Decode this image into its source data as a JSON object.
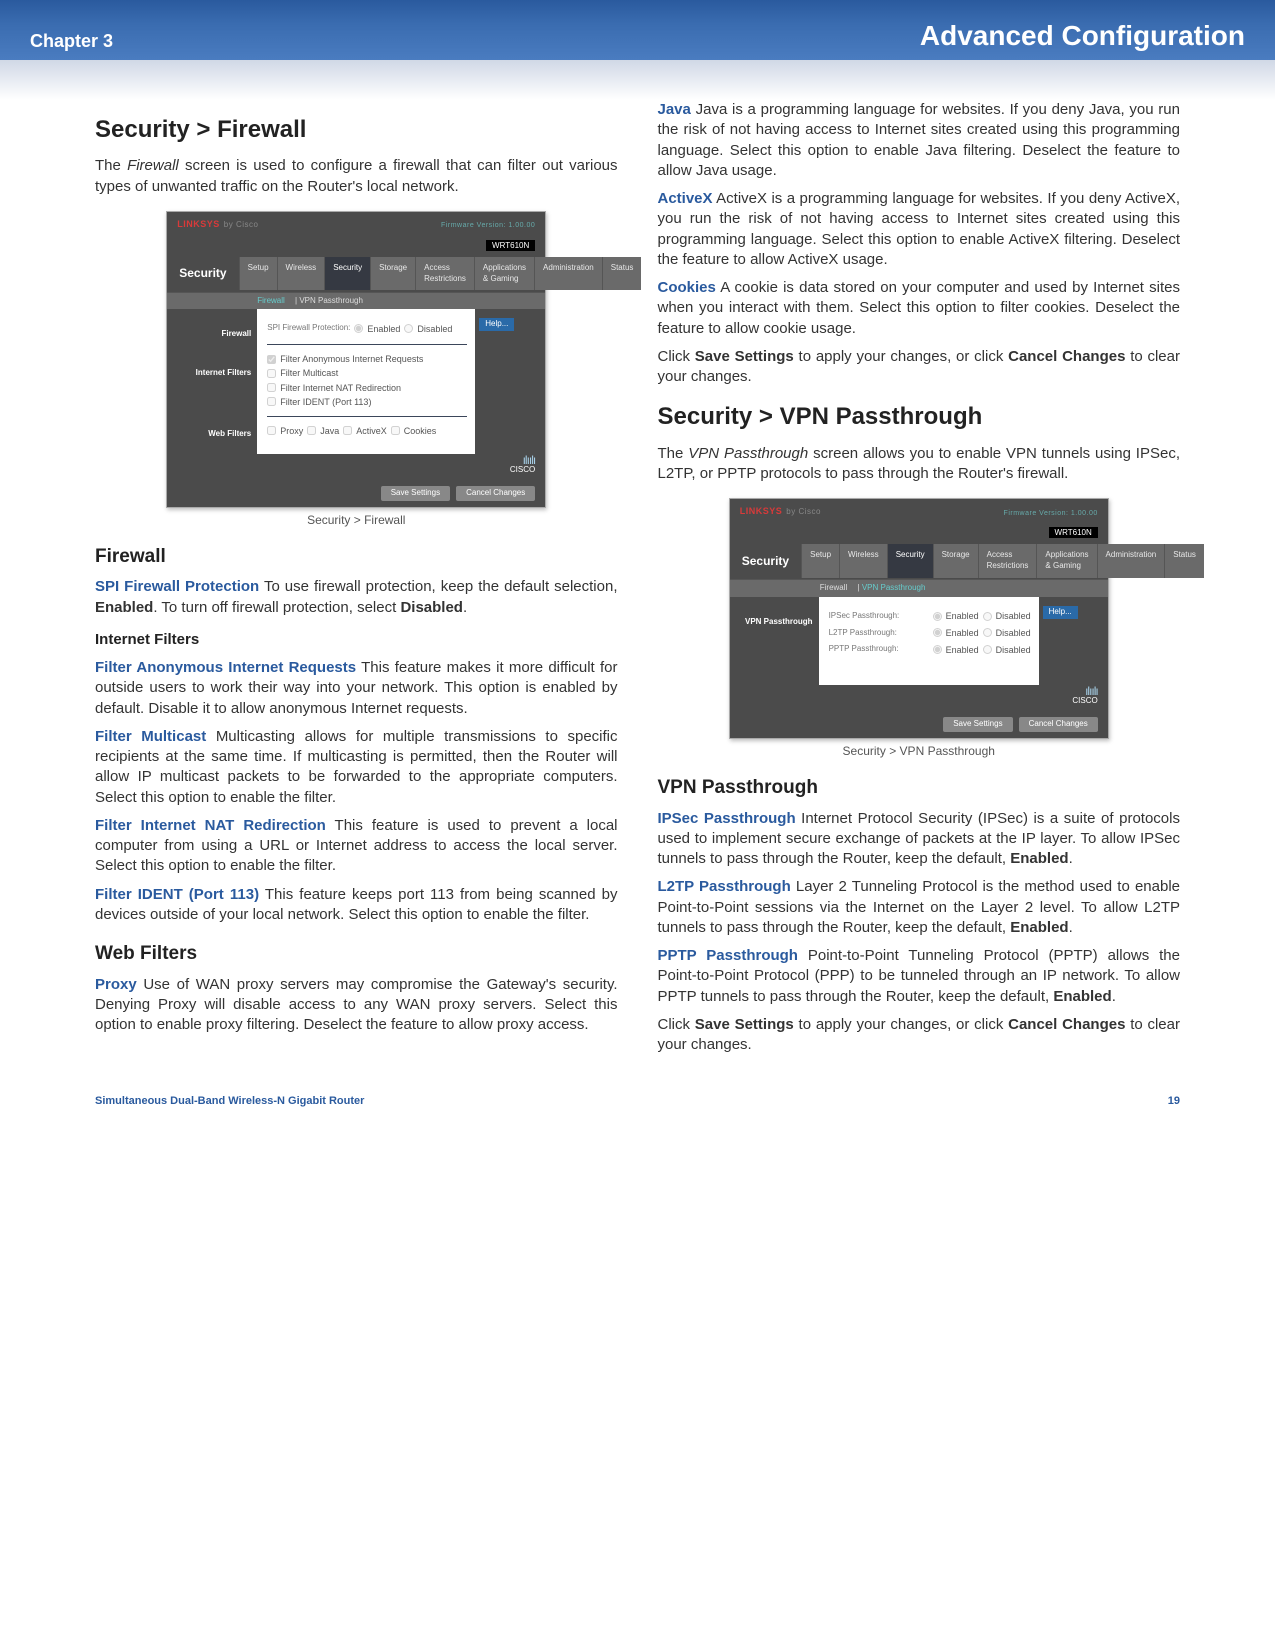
{
  "header": {
    "chapter": "Chapter 3",
    "title": "Advanced Configuration"
  },
  "footer": {
    "product": "Simultaneous Dual-Band Wireless-N Gigabit Router",
    "page": "19"
  },
  "shot_common": {
    "brand": "LINKSYS",
    "by": "by Cisco",
    "fw": "Firmware Version: 1.00.00",
    "model": "WRT610N",
    "maintab": "Security",
    "nav": [
      "Setup",
      "Wireless",
      "Security",
      "Storage",
      "Access Restrictions",
      "Applications & Gaming",
      "Administration",
      "Status"
    ],
    "help": "Help...",
    "save_btn": "Save Settings",
    "cancel_btn": "Cancel Changes",
    "cisco_bars": "ılıılı",
    "cisco_txt": "CISCO"
  },
  "shot1": {
    "subtabs_a": "Firewall",
    "subtabs_b": "VPN Passthrough",
    "side1": "Firewall",
    "side2": "Internet Filters",
    "side3": "Web Filters",
    "spi_label": "SPI Firewall Protection:",
    "spi_enabled": "Enabled",
    "spi_disabled": "Disabled",
    "f1": "Filter Anonymous Internet Requests",
    "f2": "Filter Multicast",
    "f3": "Filter Internet NAT Redirection",
    "f4": "Filter IDENT (Port 113)",
    "w1": "Proxy",
    "w2": "Java",
    "w3": "ActiveX",
    "w4": "Cookies",
    "caption": "Security > Firewall"
  },
  "shot2": {
    "subtabs_a": "Firewall",
    "subtabs_b": "VPN Passthrough",
    "side1": "VPN Passthrough",
    "r1": "IPSec Passthrough:",
    "r2": "L2TP Passthrough:",
    "r3": "PPTP Passthrough:",
    "en": "Enabled",
    "dis": "Disabled",
    "caption": "Security > VPN Passthrough"
  },
  "sec": {
    "h_firewall_page": "Security > Firewall",
    "p_firewall_intro": "The Firewall screen is used to configure a firewall that can filter out various types of unwanted traffic on the Router's local network.",
    "h_firewall": "Firewall",
    "t_spi": "SPI Firewall Protection",
    "p_spi": " To use firewall protection, keep the default selection, Enabled. To turn off firewall protection, select Disabled.",
    "h_intfilters": "Internet Filters",
    "t_anon": "Filter Anonymous Internet Requests",
    "p_anon": " This feature makes it more difficult for outside users to work their way into your network. This option is enabled by default. Disable it to allow anonymous Internet requests.",
    "t_multi": "Filter Multicast",
    "p_multi": " Multicasting allows for multiple transmissions to specific recipients at the same time. If multicasting is permitted, then the Router will allow IP multicast packets to be forwarded to the appropriate computers. Select this option to enable the filter.",
    "t_nat": "Filter Internet NAT Redirection",
    "p_nat": "  This feature is used to prevent a local computer from using a URL or Internet address to access the local server. Select this option to enable the filter.",
    "t_ident": "Filter IDENT (Port 113)",
    "p_ident": "  This feature keeps port 113 from being scanned by devices outside of your local network. Select this option to enable the filter.",
    "h_webfilters": "Web Filters",
    "t_proxy": "Proxy",
    "p_proxy": "  Use of WAN proxy servers may compromise the Gateway's security. Denying Proxy will disable access to any WAN proxy servers. Select this option to enable proxy filtering. Deselect the feature to allow proxy access.",
    "t_java": "Java",
    "p_java": "   Java is a programming language for websites. If you deny Java, you run the risk of not having access to Internet sites created using this programming language. Select this option to enable Java filtering. Deselect the feature to allow Java usage.",
    "t_activex": "ActiveX",
    "p_activex": "   ActiveX is a programming language for websites. If you deny ActiveX, you run the risk of not having access to Internet sites created using this programming language. Select this option to enable ActiveX filtering. Deselect the feature to allow ActiveX usage.",
    "t_cookies": "Cookies",
    "p_cookies": "  A cookie is data stored on your computer and used by Internet sites when you interact with them. Select this option to filter cookies. Deselect the feature to allow cookie usage.",
    "p_save1": "Click Save Settings to apply your changes, or click Cancel Changes to clear your changes.",
    "h_vpn_page": "Security > VPN Passthrough",
    "p_vpn_intro": "The VPN Passthrough screen allows you to enable VPN tunnels using IPSec, L2TP, or PPTP protocols to pass through the Router's firewall.",
    "h_vpnpass": "VPN Passthrough",
    "t_ipsec": "IPSec Passthrough",
    "p_ipsec": "  Internet Protocol Security (IPSec) is a suite of protocols used to implement secure exchange of packets at the IP layer. To allow IPSec tunnels to pass through the Router, keep the default, Enabled.",
    "t_l2tp": "L2TP Passthrough",
    "p_l2tp": "  Layer 2 Tunneling Protocol is the method used to enable Point-to-Point sessions via the Internet on the Layer 2 level. To allow L2TP tunnels to pass through the Router, keep the default, Enabled.",
    "t_pptp": "PPTP Passthrough",
    "p_pptp": "  Point-to-Point Tunneling Protocol (PPTP) allows the Point-to-Point Protocol (PPP) to be tunneled through an IP network. To allow PPTP tunnels to pass through the Router, keep the default, Enabled.",
    "p_save2": "Click Save Settings to apply your changes, or click Cancel Changes to clear your changes."
  }
}
